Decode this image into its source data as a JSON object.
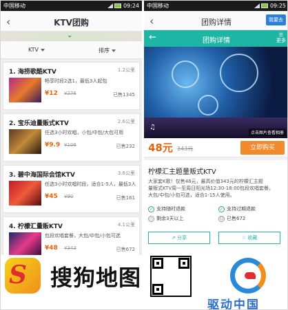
{
  "status_left": {
    "carrier": "中国移动",
    "time": "09:24"
  },
  "status_right": {
    "carrier": "中国移动",
    "time": "09:25"
  },
  "left": {
    "title": "KTV团购",
    "filters": [
      "KTV",
      "排序"
    ],
    "items": [
      {
        "name": "1. 海捞歌酷KTV",
        "distance": "1.2公里",
        "desc": "畅享时段2选1，最低3人起包",
        "price": "¥12",
        "orig": "¥276",
        "sold": "已售1345"
      },
      {
        "name": "2. 宝乐迪量贩式KTV",
        "distance": "2.6公里",
        "desc": "任选3小时欢唱，小包/中包/大包可用",
        "price": "¥9.9",
        "orig": "¥106",
        "sold": "已售232"
      },
      {
        "name": "3. 碧中海国际会馆KTV",
        "distance": "3.6公里",
        "desc": "任选3小时欢唱时段，适合1-5人，最低3人",
        "price": "¥45",
        "orig": "¥90",
        "sold": "已售161"
      },
      {
        "name": "4. 柠檬汇量贩KTV",
        "distance": "4.1公里",
        "desc": "包段欢唱套餐，大包/中包/小包可选",
        "price": "¥48",
        "orig": "¥343",
        "sold": "已售672"
      }
    ]
  },
  "right": {
    "header_title": "团购详情",
    "ask_label": "我要去",
    "bar_title": "团购详情",
    "more_label": "更多",
    "hero_caption": "点击图片查看相册",
    "price_now": "48元",
    "price_was": "343元",
    "buy_label": "立即购买",
    "name": "柠檬汇主题量贩式KTV",
    "desc": "大家套K歌！仅售48元，最高价值343元的柠檬汇主题\n量贩式KTV周一至周日阳光场12:30-18:00包段欢唱套餐，\n大包/中包/小包可选，适合1-15人使用。",
    "tags": [
      "支持随时退款",
      "支持过期退款",
      "剩余3天以上",
      "已售672"
    ],
    "share_label": "分享",
    "fav_label": "收藏"
  },
  "footer": {
    "sogou_text": "搜狗地图",
    "qd_text": "驱动中国"
  }
}
